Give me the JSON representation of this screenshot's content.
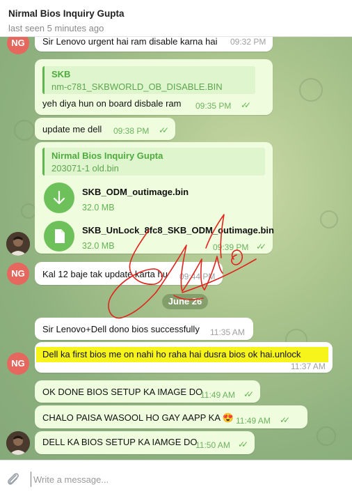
{
  "header": {
    "title": "Nirmal Bios Inquiry Gupta",
    "status": "last seen 5 minutes ago"
  },
  "avatars": {
    "ng_initials": "NG"
  },
  "messages": {
    "m1": {
      "text": "Sir Lenovo urgent hai ram disable karna hai",
      "time": "09:32 PM"
    },
    "m2": {
      "reply_name": "SKB",
      "reply_text": "nm-c781_SKBWORLD_OB_DISABLE.BIN",
      "text": "yeh diya hun on board disbale ram",
      "time": "09:35 PM"
    },
    "m3": {
      "text": "update me dell",
      "time": "09:38 PM"
    },
    "m4": {
      "reply_name": "Nirmal Bios Inquiry Gupta",
      "reply_text": "203071-1 old.bin",
      "file1_name": "SKB_ODM_outimage.bin",
      "file1_size": "32.0 MB",
      "file2_name": "SKB_UnLock_8fc8_SKB_ODM_outimage.bin",
      "file2_size": "32.0 MB",
      "time": "09:39 PM"
    },
    "m5": {
      "text": "Kal 12 baje tak update karta hu",
      "time": "09:44 PM"
    },
    "date_separator": "June 26",
    "m6": {
      "text": "Sir Lenovo+Dell dono bios successfully",
      "time": "11:35 AM"
    },
    "m7": {
      "text": "Dell ka first bios me on nahi ho raha hai dusra bios ok hai.unlock",
      "time": "11:37 AM"
    },
    "m8": {
      "text": "OK DONE BIOS SETUP KA IMAGE DO",
      "time": "11:49 AM"
    },
    "m9": {
      "text": "CHALO PAISA WASOOL HO GAY AAPP KA",
      "emoji": "😍",
      "time": "11:49 AM"
    },
    "m10": {
      "text": "DELL KA BIOS SETUP KA IAMGE DO",
      "time": "11:50 AM"
    }
  },
  "composer": {
    "placeholder": "Write a message..."
  },
  "icons": {
    "check": "double-check-icon",
    "download": "download-arrow-icon",
    "file": "document-icon",
    "attach": "paperclip-icon"
  },
  "colors": {
    "outgoing_bubble": "#effdde",
    "incoming_bubble": "#ffffff",
    "accent_green": "#5fb550",
    "avatar_red": "#e5675d",
    "highlight": "#f6f41a",
    "scribble": "#e0231c"
  }
}
